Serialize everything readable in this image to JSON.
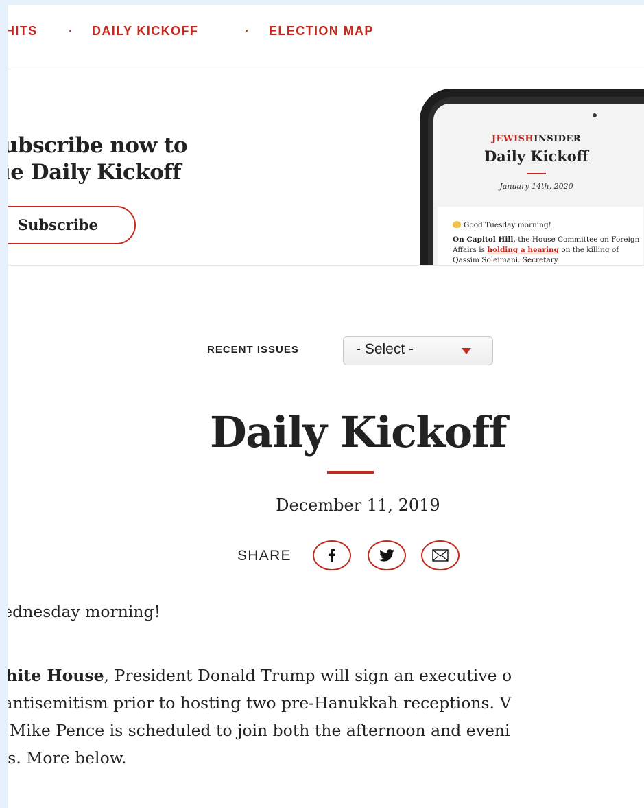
{
  "nav": {
    "item1": "HITS",
    "sep1": "·",
    "item2": "DAILY KICKOFF",
    "sep2": "·",
    "item3": "ELECTION MAP"
  },
  "promo": {
    "title_line1": "ubscribe now to",
    "title_line2": "ıe Daily Kickoff",
    "subscribe_label": "Subscribe"
  },
  "phone": {
    "brand_jewish": "JEWISH",
    "brand_insider": "INSIDER",
    "title": "Daily Kickoff",
    "date": "January 14th, 2020",
    "greeting": "Good Tuesday morning!",
    "para_bold": "On Capitol Hill,",
    "para_text1": " the House Committee on Foreign Affairs is ",
    "para_link": "holding a hearing",
    "para_text2": " on the killing of Qassim Soleimani. Secretary"
  },
  "issues": {
    "label": "RECENT ISSUES",
    "selected": "- Select -"
  },
  "article": {
    "title": "Daily Kickoff",
    "date": "December 11, 2019",
    "share_label": "SHARE",
    "greeting": "Wednesday morning!",
    "lead_bold": "White House",
    "line1": ", President Donald Trump will sign an executive o",
    "line2": "g antisemitism prior to hosting two pre-Hanukkah receptions. V",
    "line3": "nt Mike Pence is scheduled to join both the afternoon and eveni",
    "line4": "ons. More below."
  },
  "colors": {
    "accent": "#c3291c",
    "background": "#e7f1fb"
  },
  "icons": [
    "facebook-icon",
    "twitter-icon",
    "mail-icon",
    "caret-down-icon",
    "waving-hand-icon"
  ]
}
